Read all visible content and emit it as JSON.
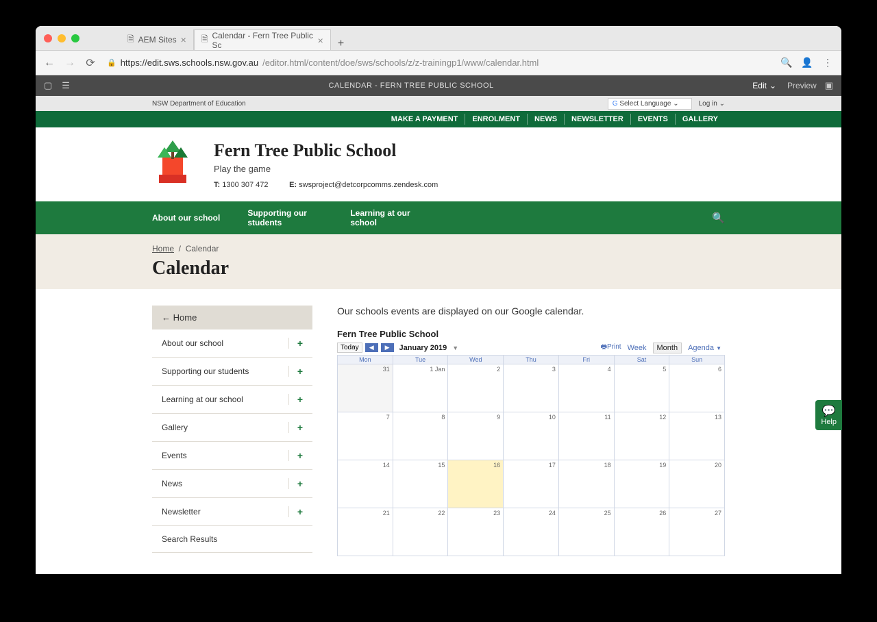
{
  "browser": {
    "tabs": [
      {
        "title": "AEM Sites",
        "active": false
      },
      {
        "title": "Calendar - Fern Tree Public Sc",
        "active": true
      }
    ],
    "url_host": "https://edit.sws.schools.nsw.gov.au",
    "url_path": "/editor.html/content/doe/sws/schools/z/z-trainingp1/www/calendar.html"
  },
  "aem": {
    "title": "CALENDAR - FERN TREE PUBLIC SCHOOL",
    "edit": "Edit",
    "preview": "Preview"
  },
  "topstrip": {
    "dept": "NSW Department of Education",
    "lang": "Select Language",
    "login": "Log in"
  },
  "greenlinks": [
    "MAKE A PAYMENT",
    "ENROLMENT",
    "NEWS",
    "NEWSLETTER",
    "EVENTS",
    "GALLERY"
  ],
  "school": {
    "name": "Fern Tree Public School",
    "tagline": "Play the game",
    "phone_label": "T:",
    "phone": "1300 307 472",
    "email_label": "E:",
    "email": "swsproject@detcorpcomms.zendesk.com"
  },
  "mainnav": [
    "About our school",
    "Supporting our students",
    "Learning at our school"
  ],
  "crumb": {
    "home": "Home",
    "current": "Calendar"
  },
  "page_title": "Calendar",
  "sidebar": {
    "home": "Home",
    "items": [
      {
        "label": "About our school",
        "expandable": true
      },
      {
        "label": "Supporting our students",
        "expandable": true
      },
      {
        "label": "Learning at our school",
        "expandable": true
      },
      {
        "label": "Gallery",
        "expandable": true
      },
      {
        "label": "Events",
        "expandable": true
      },
      {
        "label": "News",
        "expandable": true
      },
      {
        "label": "Newsletter",
        "expandable": true
      },
      {
        "label": "Search Results",
        "expandable": false
      }
    ]
  },
  "calendar": {
    "intro": "Our schools events are displayed on our Google calendar.",
    "name": "Fern Tree Public School",
    "today": "Today",
    "month_label": "January 2019",
    "print": "Print",
    "views": {
      "week": "Week",
      "month": "Month",
      "agenda": "Agenda"
    },
    "days": [
      "Mon",
      "Tue",
      "Wed",
      "Thu",
      "Fri",
      "Sat",
      "Sun"
    ],
    "weeks": [
      [
        {
          "n": "31",
          "prev": true
        },
        {
          "n": "1 Jan"
        },
        {
          "n": "2"
        },
        {
          "n": "3"
        },
        {
          "n": "4"
        },
        {
          "n": "5"
        },
        {
          "n": "6"
        }
      ],
      [
        {
          "n": "7"
        },
        {
          "n": "8"
        },
        {
          "n": "9"
        },
        {
          "n": "10"
        },
        {
          "n": "11"
        },
        {
          "n": "12"
        },
        {
          "n": "13"
        }
      ],
      [
        {
          "n": "14"
        },
        {
          "n": "15"
        },
        {
          "n": "16",
          "today": true
        },
        {
          "n": "17"
        },
        {
          "n": "18"
        },
        {
          "n": "19"
        },
        {
          "n": "20"
        }
      ],
      [
        {
          "n": "21"
        },
        {
          "n": "22"
        },
        {
          "n": "23"
        },
        {
          "n": "24"
        },
        {
          "n": "25"
        },
        {
          "n": "26"
        },
        {
          "n": "27"
        }
      ]
    ]
  },
  "help": "Help"
}
